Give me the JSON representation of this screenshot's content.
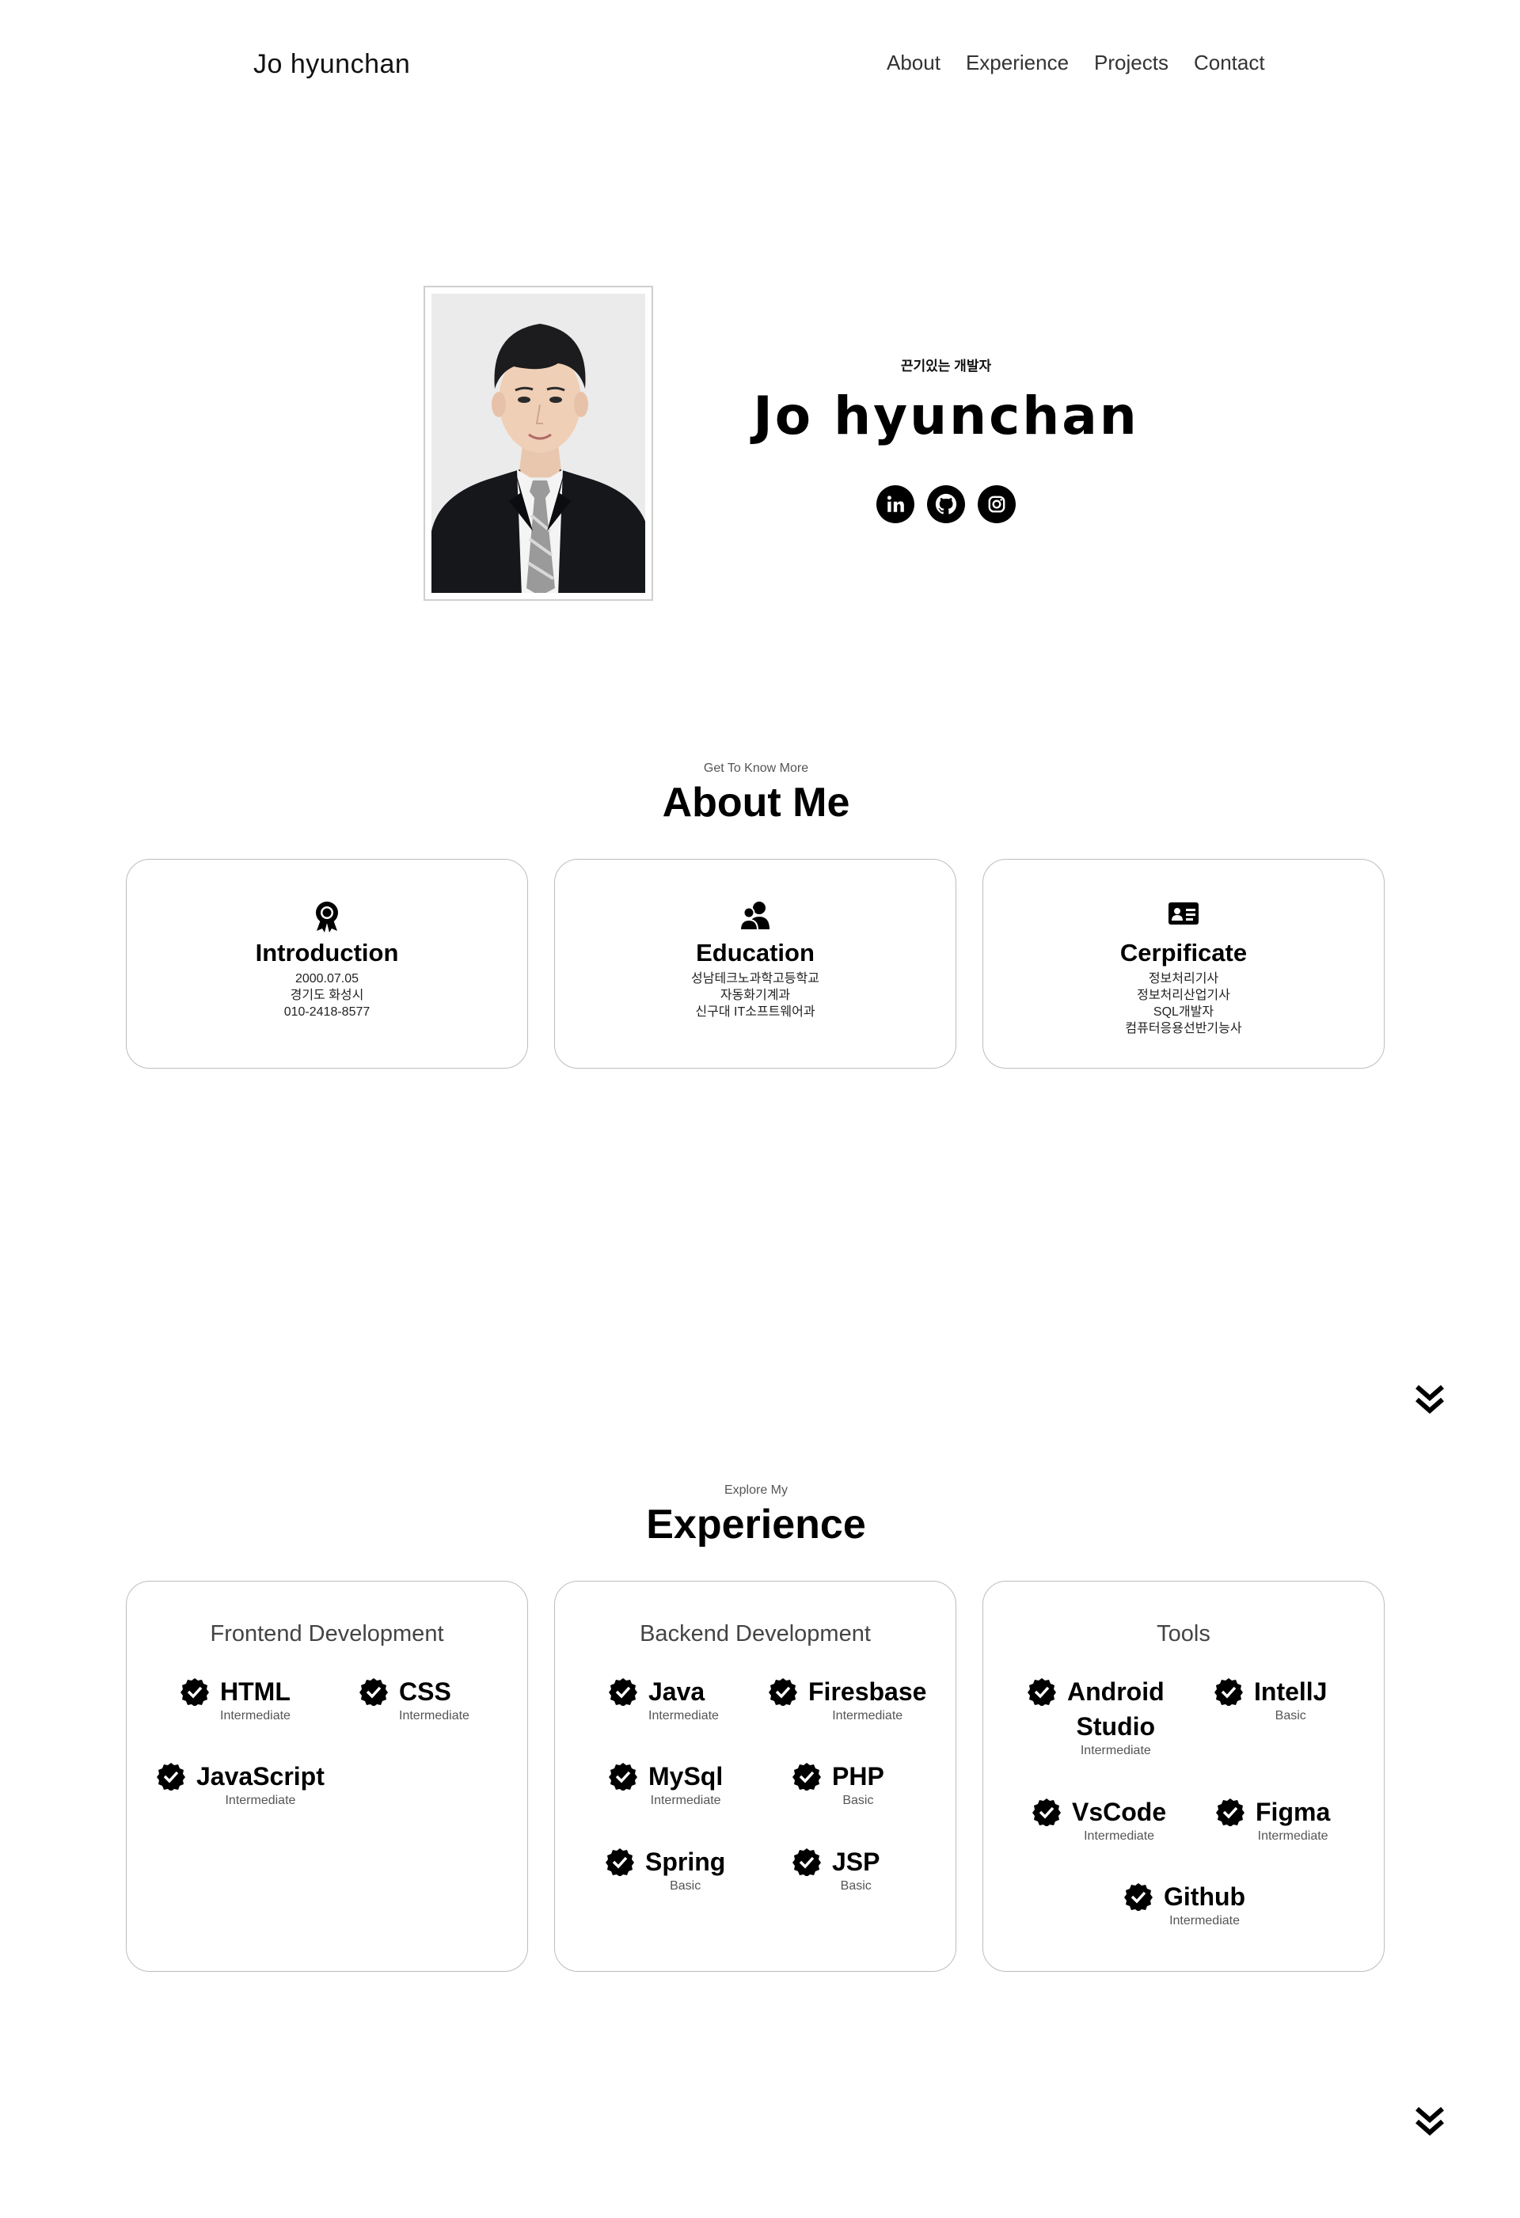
{
  "nav": {
    "logo": "Jo hyunchan",
    "links": [
      "About",
      "Experience",
      "Projects",
      "Contact"
    ]
  },
  "hero": {
    "subtitle": "끈기있는 개발자",
    "name": "Jo hyunchan",
    "socials": [
      "linkedin-icon",
      "github-icon",
      "instagram-icon"
    ]
  },
  "about": {
    "subtitle": "Get To Know More",
    "title": "About Me",
    "cards": [
      {
        "icon": "award-icon",
        "title": "Introduction",
        "lines": [
          "2000.07.05",
          "경기도 화성시",
          "010-2418-8577"
        ]
      },
      {
        "icon": "users-icon",
        "title": "Education",
        "lines": [
          "성남테크노과학고등학교",
          "자동화기계과",
          "신구대 IT소프트웨어과"
        ]
      },
      {
        "icon": "id-card-icon",
        "title": "Cerpificate",
        "lines": [
          "정보처리기사",
          "정보처리산업기사",
          "SQL개발자",
          "컴퓨터응용선반기능사"
        ]
      }
    ]
  },
  "experience": {
    "subtitle": "Explore My",
    "title": "Experience",
    "cards": [
      {
        "title": "Frontend Development",
        "skills": [
          {
            "name": "HTML",
            "level": "Intermediate"
          },
          {
            "name": "CSS",
            "level": "Intermediate"
          },
          {
            "name": "JavaScript",
            "level": "Intermediate"
          }
        ]
      },
      {
        "title": "Backend Development",
        "skills": [
          {
            "name": "Java",
            "level": "Intermediate"
          },
          {
            "name": "Firesbase",
            "level": "Intermediate"
          },
          {
            "name": "MySql",
            "level": "Intermediate"
          },
          {
            "name": "PHP",
            "level": "Basic"
          },
          {
            "name": "Spring",
            "level": "Basic"
          },
          {
            "name": "JSP",
            "level": "Basic"
          }
        ]
      },
      {
        "title": "Tools",
        "skills": [
          {
            "name": "Android Studio",
            "line1": "Android",
            "line2": "Studio",
            "level": "Intermediate"
          },
          {
            "name": "IntellJ",
            "level": "Basic"
          },
          {
            "name": "VsCode",
            "level": "Intermediate"
          },
          {
            "name": "Figma",
            "level": "Intermediate"
          },
          {
            "name": "Github",
            "level": "Intermediate"
          }
        ]
      }
    ]
  },
  "icons": {
    "scroll": "double-chevron-down-icon",
    "skill": "verified-check-icon"
  }
}
